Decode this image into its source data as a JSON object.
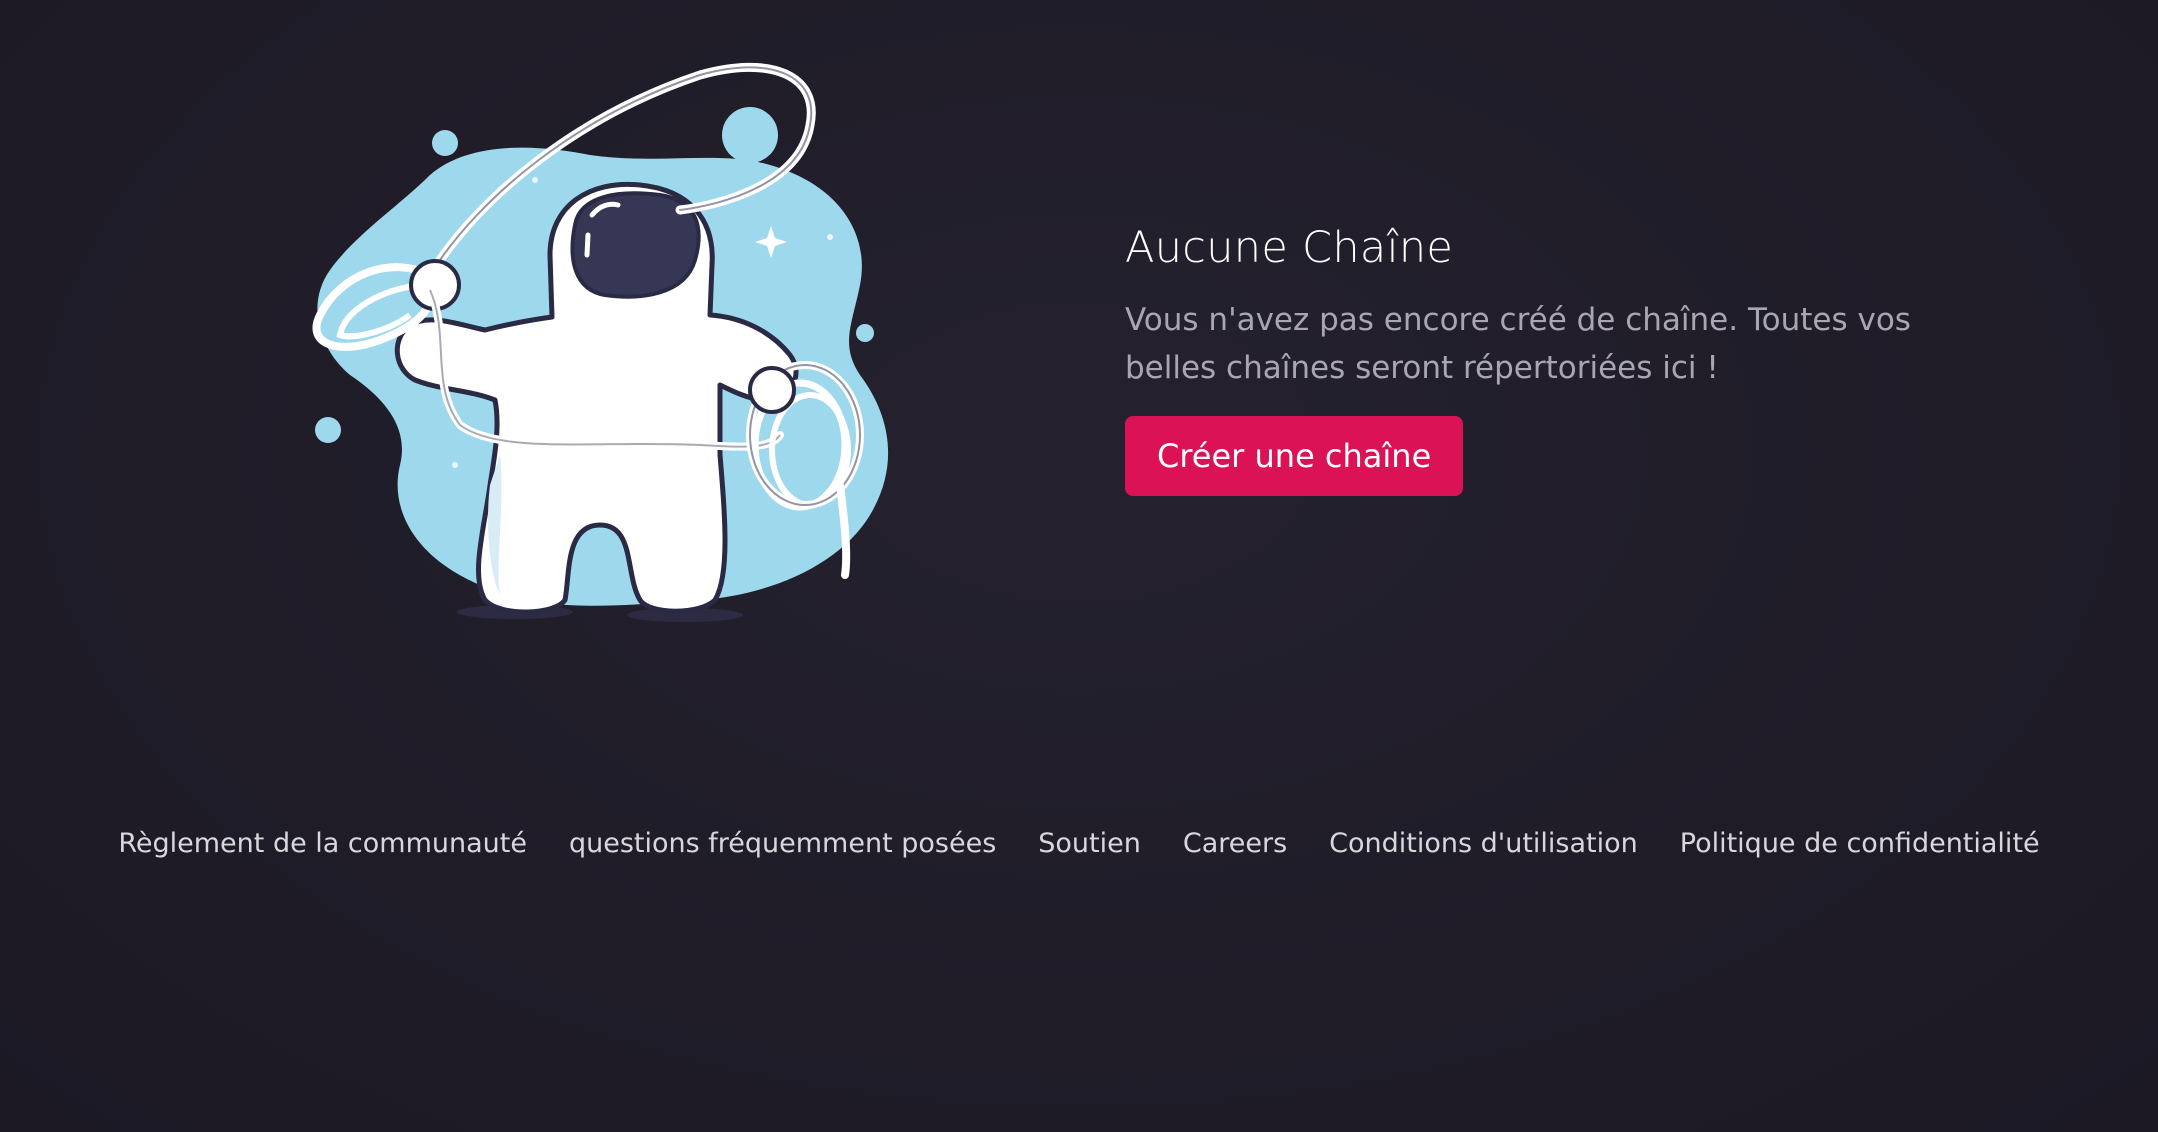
{
  "empty_state": {
    "title": "Aucune Chaîne",
    "description": "Vous n'avez pas encore créé de chaîne. Toutes vos belles chaînes seront répertoriées ici !",
    "create_button_label": "Créer une chaîne"
  },
  "illustration": {
    "icon": "astronaut-with-lasso-illustration"
  },
  "footer": {
    "links": [
      "Règlement de la communauté",
      "questions fréquemment posées",
      "Soutien",
      "Careers",
      "Conditions d'utilisation",
      "Politique de confidentialité"
    ]
  },
  "colors": {
    "background": "#1f1c28",
    "accent": "#dc1257",
    "blob": "#9ed8ec"
  }
}
